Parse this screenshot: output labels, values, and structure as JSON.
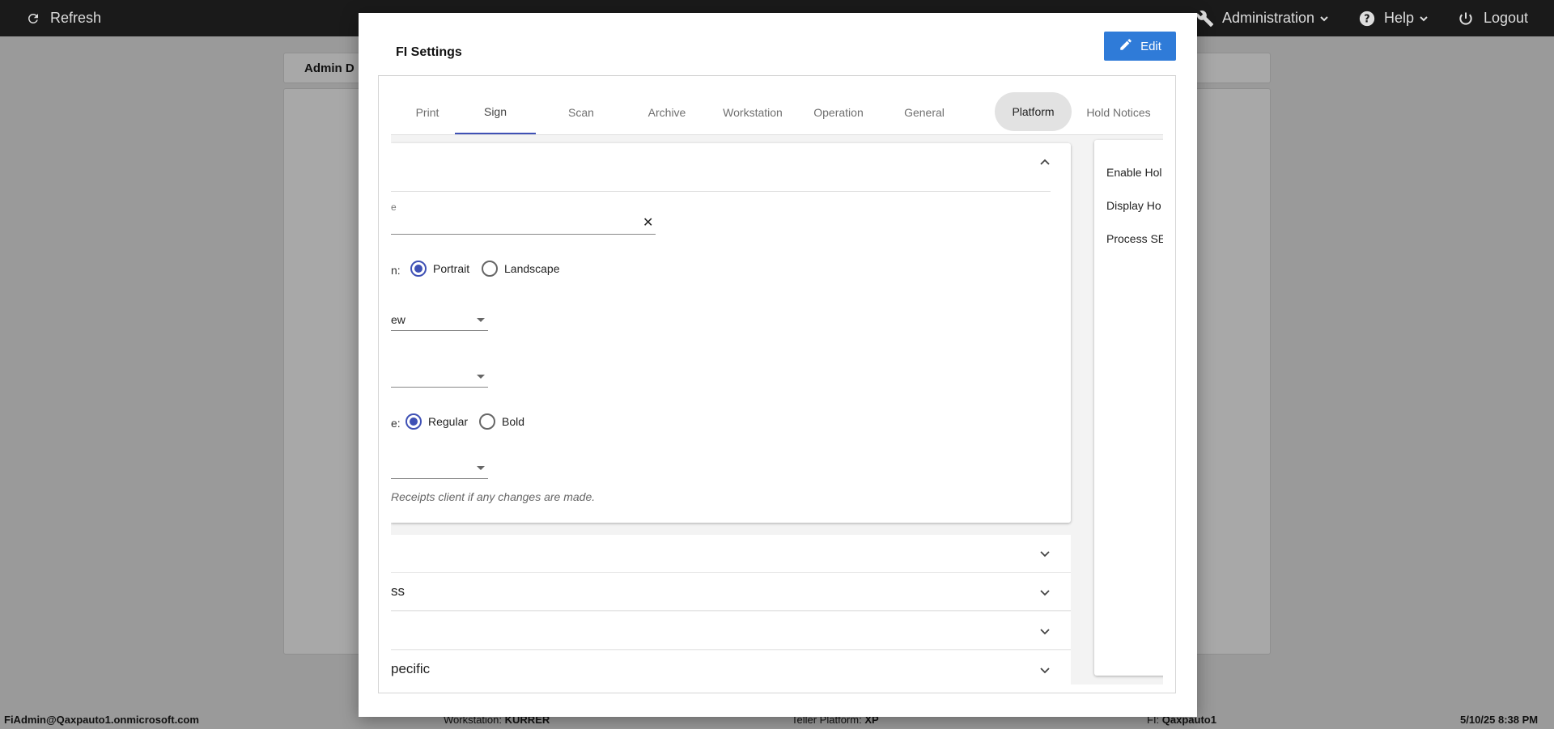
{
  "topbar": {
    "refresh_label": "Refresh",
    "administration_label": "Administration",
    "help_label": "Help",
    "logout_label": "Logout"
  },
  "background": {
    "header_title": "Admin D"
  },
  "statusbar": {
    "user": "FiAdmin@Qaxpauto1.onmicrosoft.com",
    "workstation_label": "Workstation:",
    "workstation_value": "KURRER",
    "teller_label": "Teller Platform:",
    "teller_value": "XP",
    "fi_label": "FI:",
    "fi_value": "Qaxpauto1",
    "datetime": "5/10/25 8:38 PM"
  },
  "modal": {
    "title": "FI Settings",
    "edit_label": "Edit",
    "tabs": [
      {
        "label": "Print"
      },
      {
        "label": "Sign"
      },
      {
        "label": "Scan"
      },
      {
        "label": "Archive"
      },
      {
        "label": "Workstation"
      },
      {
        "label": "Operation"
      },
      {
        "label": "General"
      },
      {
        "label": "Platform"
      },
      {
        "label": "Hold Notices"
      }
    ],
    "active_tab": "Sign",
    "card": {
      "field1_label": "e",
      "orientation_label": "n:",
      "orientation_options": [
        "Portrait",
        "Landscape"
      ],
      "orientation_selected": "Portrait",
      "select1_value": "ew",
      "select2_value": "",
      "style_label": "e:",
      "style_options": [
        "Regular",
        "Bold"
      ],
      "style_selected": "Regular",
      "select3_value": "",
      "note": "Receipts client if any changes are made."
    },
    "accordion": [
      {
        "label": ""
      },
      {
        "label": "ss"
      },
      {
        "label": ""
      },
      {
        "label": "pecific"
      }
    ],
    "right_panel": [
      "Enable Hol",
      "Display Ho",
      "Process SE"
    ]
  },
  "colors": {
    "accent": "#3f51b5",
    "edit_button": "#2f7bd8",
    "topbar": "#1a1a1a",
    "overlay": "#9a9a9a"
  }
}
